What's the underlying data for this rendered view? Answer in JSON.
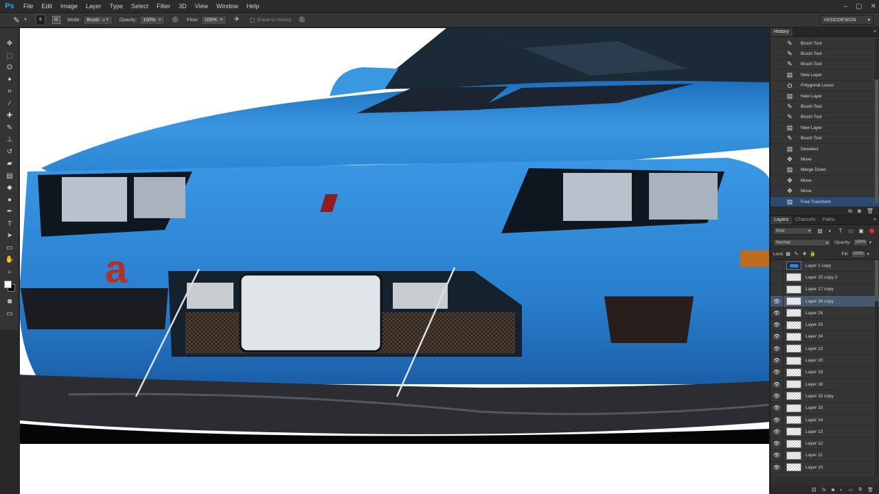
{
  "app": {
    "logo": "Ps"
  },
  "menu": [
    "File",
    "Edit",
    "Image",
    "Layer",
    "Type",
    "Select",
    "Filter",
    "3D",
    "View",
    "Window",
    "Help"
  ],
  "window_controls": [
    "–",
    "▢",
    "✕"
  ],
  "options": {
    "tool_icon": "brush-icon",
    "brush_size": "6",
    "mode_label": "Mode:",
    "mode_value": "Brush",
    "opacity_label": "Opacity:",
    "opacity_value": "100%",
    "flow_label": "Flow:",
    "flow_value": "100%",
    "erase_label": "Erase to History",
    "workspace": "YASIDDESIGN"
  },
  "tools": [
    "move-icon",
    "marquee-icon",
    "lasso-icon",
    "quick-select-icon",
    "crop-icon",
    "eyedropper-icon",
    "healing-icon",
    "brush-icon",
    "clone-stamp-icon",
    "history-brush-icon",
    "eraser-icon",
    "gradient-icon",
    "blur-icon",
    "dodge-icon",
    "pen-icon",
    "type-icon",
    "path-select-icon",
    "shape-icon",
    "hand-icon",
    "zoom-icon"
  ],
  "history": {
    "title": "History",
    "items": [
      {
        "label": "Brush Tool",
        "icon": "brush-icon"
      },
      {
        "label": "Brush Tool",
        "icon": "brush-icon"
      },
      {
        "label": "Brush Tool",
        "icon": "brush-icon"
      },
      {
        "label": "New Layer",
        "icon": "layer-icon"
      },
      {
        "label": "Polygonal Lasso",
        "icon": "lasso-icon"
      },
      {
        "label": "New Layer",
        "icon": "layer-icon"
      },
      {
        "label": "Brush Tool",
        "icon": "brush-icon"
      },
      {
        "label": "Brush Tool",
        "icon": "brush-icon"
      },
      {
        "label": "New Layer",
        "icon": "layer-icon"
      },
      {
        "label": "Brush Tool",
        "icon": "brush-icon"
      },
      {
        "label": "Deselect",
        "icon": "layer-icon"
      },
      {
        "label": "Move",
        "icon": "move-icon"
      },
      {
        "label": "Merge Down",
        "icon": "layer-icon"
      },
      {
        "label": "Move",
        "icon": "move-icon"
      },
      {
        "label": "Move",
        "icon": "move-icon"
      },
      {
        "label": "Free Transform",
        "icon": "layer-icon"
      }
    ],
    "active_index": 15
  },
  "layers": {
    "tabs": [
      "Layers",
      "Channels",
      "Paths"
    ],
    "kind": "Kind",
    "blend_mode": "Normal",
    "opacity_label": "Opacity:",
    "opacity_value": "100%",
    "lock_label": "Lock:",
    "fill_label": "Fill:",
    "fill_value": "100%",
    "items": [
      {
        "name": "Layer 1 copy",
        "visible": false,
        "thumb": "car"
      },
      {
        "name": "Layer 15 copy 2",
        "visible": false,
        "thumb": "transparent"
      },
      {
        "name": "Layer 17 copy",
        "visible": false,
        "thumb": "transparent"
      },
      {
        "name": "Layer 26 copy",
        "visible": true,
        "thumb": "transparent"
      },
      {
        "name": "Layer 26",
        "visible": true,
        "thumb": "transparent"
      },
      {
        "name": "Layer 25",
        "visible": true,
        "thumb": "transparent"
      },
      {
        "name": "Layer 24",
        "visible": true,
        "thumb": "transparent"
      },
      {
        "name": "Layer 23",
        "visible": true,
        "thumb": "transparent"
      },
      {
        "name": "Layer 20",
        "visible": true,
        "thumb": "transparent"
      },
      {
        "name": "Layer 19",
        "visible": true,
        "thumb": "transparent"
      },
      {
        "name": "Layer 18",
        "visible": true,
        "thumb": "transparent"
      },
      {
        "name": "Layer 15 copy",
        "visible": true,
        "thumb": "transparent"
      },
      {
        "name": "Layer 15",
        "visible": true,
        "thumb": "transparent"
      },
      {
        "name": "Layer 14",
        "visible": true,
        "thumb": "transparent"
      },
      {
        "name": "Layer 13",
        "visible": true,
        "thumb": "transparent"
      },
      {
        "name": "Layer 12",
        "visible": true,
        "thumb": "transparent"
      },
      {
        "name": "Layer 11",
        "visible": true,
        "thumb": "transparent"
      },
      {
        "name": "Layer 10",
        "visible": true,
        "thumb": "transparent"
      }
    ],
    "active_index": 3
  },
  "colors": {
    "accent": "#2aa8e8",
    "car_blue": "#2f86d2",
    "active_layer": "#46576e"
  }
}
